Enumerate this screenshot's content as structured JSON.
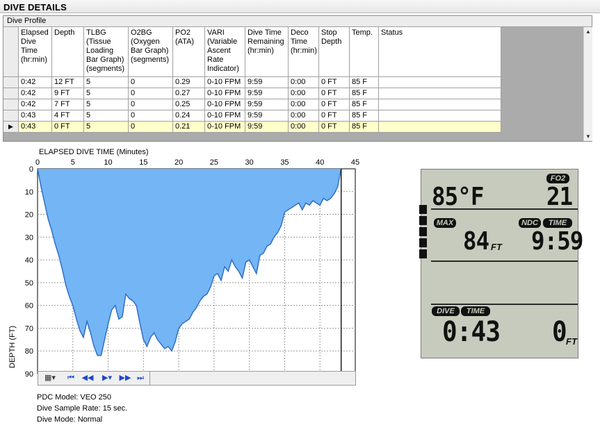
{
  "window": {
    "title": "DIVE DETAILS"
  },
  "grid": {
    "caption": "Dive Profile",
    "headers": [
      "Elapsed Dive Time (hr:min)",
      "Depth",
      "TLBG (Tissue Loading Bar Graph) (segments)",
      "O2BG (Oxygen Bar Graph) (segments)",
      "PO2 (ATA)",
      "VARI (Variable Ascent Rate Indicator)",
      "Dive Time Remaining (hr:min)",
      "Deco Time (hr:min)",
      "Stop Depth",
      "Temp.",
      "Status"
    ],
    "rows": [
      [
        "0:42",
        "12 FT",
        "5",
        "0",
        "0.29",
        "0-10 FPM",
        "9:59",
        "0:00",
        "0 FT",
        "85 F",
        ""
      ],
      [
        "0:42",
        "9 FT",
        "5",
        "0",
        "0.27",
        "0-10 FPM",
        "9:59",
        "0:00",
        "0 FT",
        "85 F",
        ""
      ],
      [
        "0:42",
        "7 FT",
        "5",
        "0",
        "0.25",
        "0-10 FPM",
        "9:59",
        "0:00",
        "0 FT",
        "85 F",
        ""
      ],
      [
        "0:43",
        "4 FT",
        "5",
        "0",
        "0.24",
        "0-10 FPM",
        "9:59",
        "0:00",
        "0 FT",
        "85 F",
        ""
      ],
      [
        "0:43",
        "0 FT",
        "5",
        "0",
        "0.21",
        "0-10 FPM",
        "9:59",
        "0:00",
        "0 FT",
        "85 F",
        ""
      ]
    ],
    "current_row_marker": "▶"
  },
  "chart_data": {
    "type": "area",
    "title": "",
    "xlabel": "ELAPSED DIVE TIME (Minutes)",
    "ylabel": "DEPTH (FT)",
    "xlim": [
      0,
      45
    ],
    "ylim": [
      0,
      90
    ],
    "y_inverted": true,
    "grid": true,
    "x_ticks": [
      "0",
      "5",
      "10",
      "15",
      "20",
      "25",
      "30",
      "35",
      "40",
      "45"
    ],
    "y_ticks": [
      "0",
      "10",
      "20",
      "30",
      "40",
      "50",
      "60",
      "70",
      "80",
      "90"
    ],
    "fill_color": "#73b5f5",
    "line_color": "#2f6fc4",
    "series": [
      {
        "x": [
          0,
          0.5,
          1,
          1.5,
          2,
          2.5,
          3,
          3.5,
          4,
          4.5,
          5,
          5.5,
          6,
          6.5,
          7,
          7.5,
          8,
          8.5,
          9,
          9.5,
          10,
          10.5,
          11,
          11.5,
          12,
          12.5,
          13,
          13.5,
          14,
          14.5,
          15,
          15.5,
          16,
          16.5,
          17,
          17.5,
          18,
          18.5,
          19,
          19.5,
          20,
          20.5,
          21,
          21.5,
          22,
          22.5,
          23,
          23.5,
          24,
          24.5,
          25,
          25.5,
          26,
          26.5,
          27,
          27.5,
          28,
          28.5,
          29,
          29.5,
          30,
          30.5,
          31,
          31.5,
          32,
          32.5,
          33,
          33.5,
          34,
          34.5,
          35,
          35.5,
          36,
          36.5,
          37,
          37.5,
          38,
          38.5,
          39,
          39.5,
          40,
          40.5,
          41,
          41.5,
          42,
          42.5,
          43
        ],
        "y": [
          0,
          8,
          15,
          22,
          27,
          33,
          38,
          44,
          51,
          56,
          60,
          66,
          71,
          74,
          67,
          72,
          78,
          82,
          82,
          75,
          68,
          62,
          60,
          66,
          65,
          55,
          57,
          58,
          60,
          68,
          75,
          78,
          74,
          72,
          75,
          77,
          79,
          78,
          80,
          76,
          70,
          68,
          67,
          66,
          63,
          61,
          58,
          56,
          55,
          52,
          47,
          46,
          49,
          43,
          45,
          40,
          43,
          45,
          48,
          41,
          40,
          43,
          46,
          38,
          37,
          34,
          33,
          30,
          28,
          25,
          19,
          18,
          17,
          16,
          15,
          18,
          15,
          16,
          14,
          15,
          16,
          13,
          14,
          13,
          11,
          8,
          0
        ]
      }
    ]
  },
  "toolbar": {
    "color_btn": "▦▾",
    "first": "⏮",
    "prev": "◀◀",
    "play": "▶▾",
    "next": "▶▶",
    "last": "⏭"
  },
  "info": {
    "model": "PDC Model: VEO 250",
    "rate": "Dive Sample Rate: 15 sec.",
    "mode": "Dive Mode: Normal"
  },
  "lcd": {
    "temp_value": "85",
    "temp_unit": "°F",
    "fo2_label": "FO2",
    "fo2_value": "21",
    "max_label": "MAX",
    "max_depth": "84",
    "max_unit": "FT",
    "ndc_label": "NDC",
    "time_label": "TIME",
    "ndc_time": "9:59",
    "dive_label": "DIVE",
    "dive_time_label": "TIME",
    "dive_time": "0:43",
    "current_depth": "0",
    "current_unit": "FT"
  }
}
